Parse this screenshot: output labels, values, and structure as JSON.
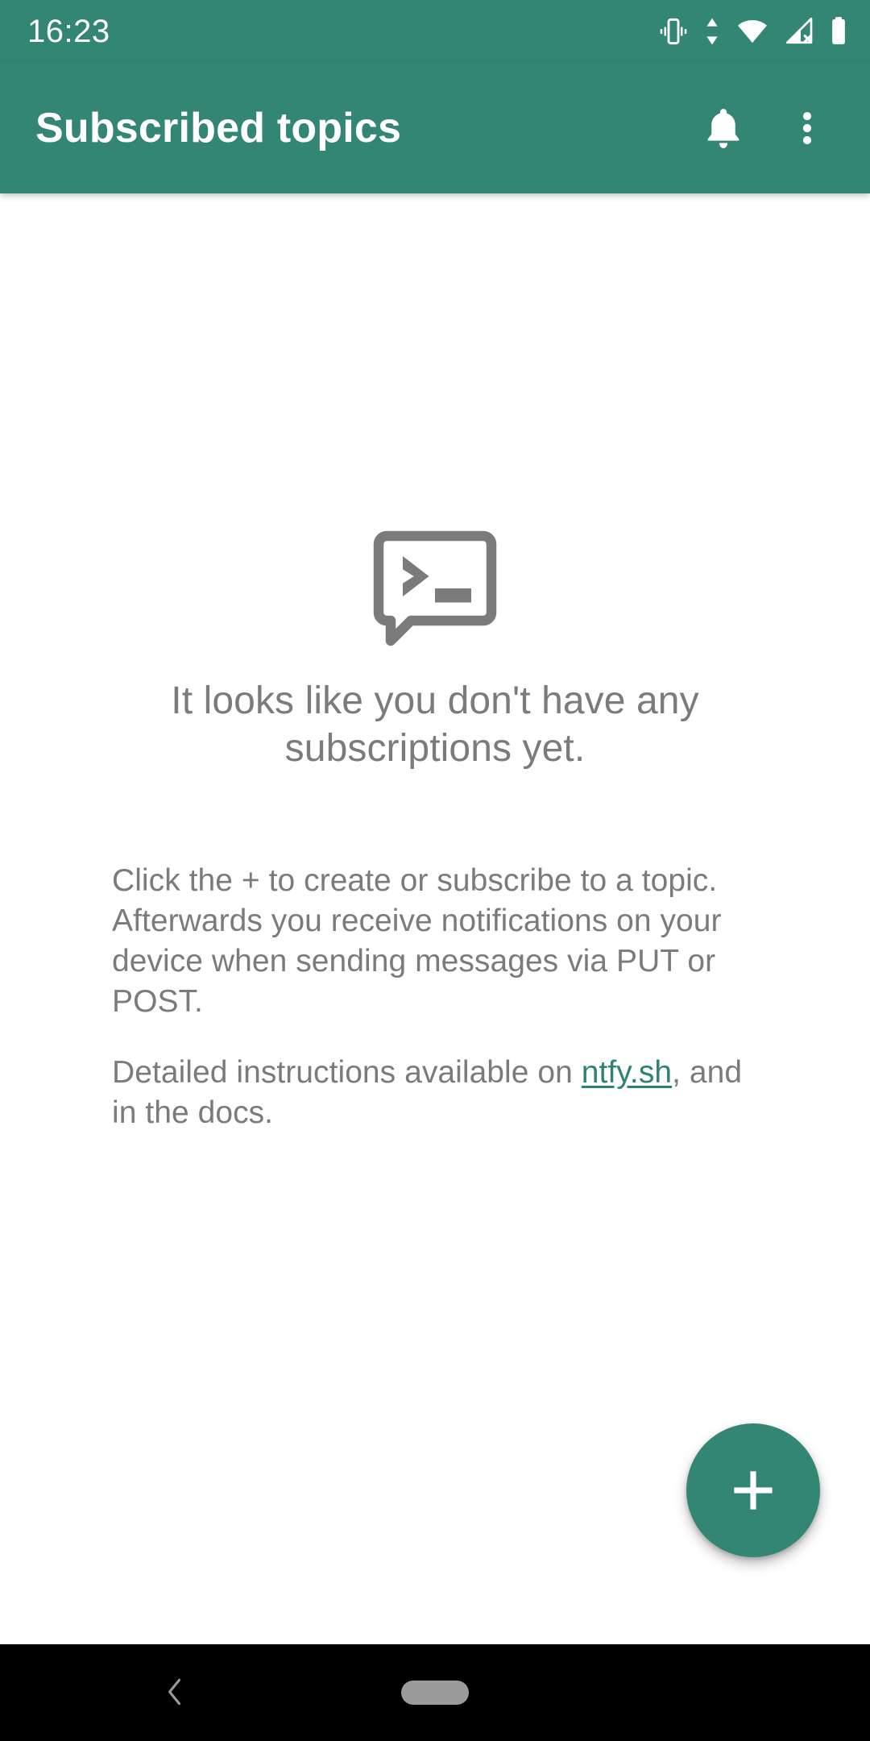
{
  "status_bar": {
    "time": "16:23",
    "icons": [
      {
        "name": "vibrate-icon",
        "label": "Vibrate mode"
      },
      {
        "name": "data-transfer-icon",
        "label": "Data transfer"
      },
      {
        "name": "wifi-icon",
        "label": "Wi-Fi connected"
      },
      {
        "name": "cellular-off-icon",
        "label": "No mobile signal"
      },
      {
        "name": "battery-icon",
        "label": "Battery full"
      }
    ]
  },
  "app_bar": {
    "title": "Subscribed topics",
    "actions": [
      {
        "name": "notification-bell-button",
        "label": "Notifications"
      },
      {
        "name": "overflow-menu-button",
        "label": "More options"
      }
    ]
  },
  "empty_state": {
    "icon_name": "ntfy-console-bubble-icon",
    "heading": "It looks like you don't have any subscriptions yet.",
    "paragraph_1": "Click the + to create or subscribe to a topic. Afterwards you receive notifications on your device when sending messages via PUT or POST.",
    "paragraph_2_before_link": "Detailed instructions available on ",
    "link_text": "ntfy.sh",
    "paragraph_2_after_link": ", and in the docs."
  },
  "fab": {
    "label": "+",
    "name": "add-subscription-fab"
  },
  "nav_bar": {
    "back_label": "Back",
    "home_label": "Home"
  },
  "colors": {
    "primary": "#338574",
    "link": "#2f8272",
    "text_muted": "#7b7b7b",
    "background": "#ffffff",
    "nav_background": "#000000"
  }
}
